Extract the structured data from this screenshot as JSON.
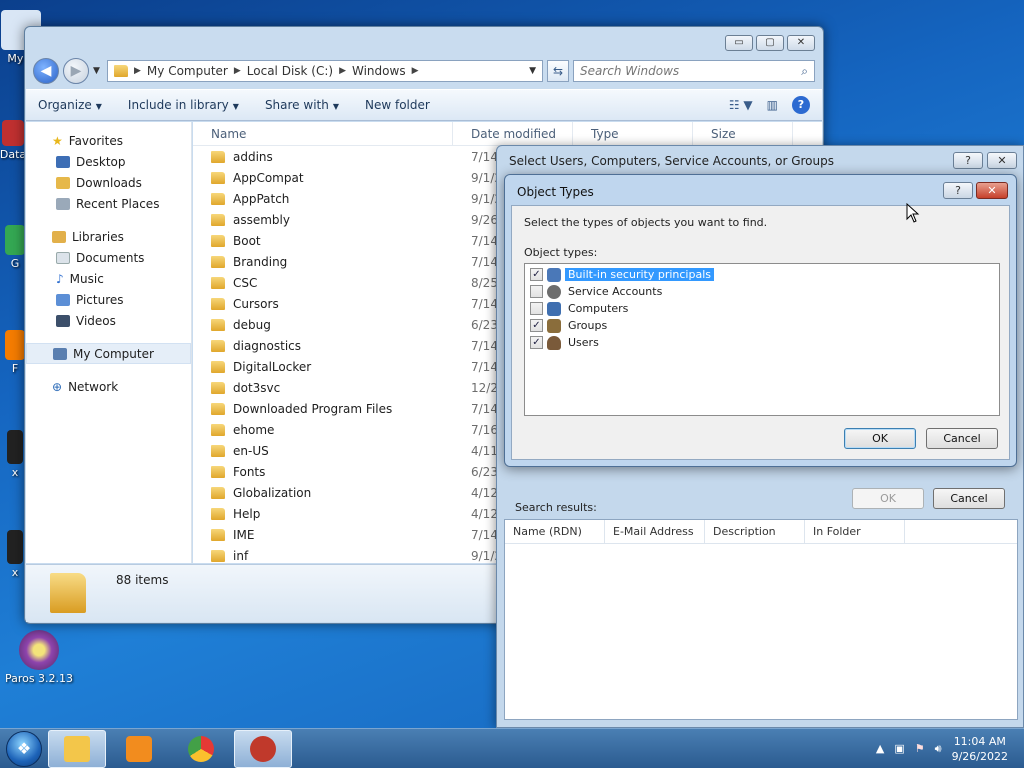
{
  "desktop": {
    "icons": [
      {
        "label": "My C",
        "color": "#d9e6f5"
      },
      {
        "label": "Data",
        "color": "#c03030"
      },
      {
        "label": "G",
        "color": "#34a853"
      },
      {
        "label": "F",
        "color": "#f57c00"
      },
      {
        "label": "x",
        "color": "#222222"
      },
      {
        "label": "x",
        "color": "#222222"
      }
    ],
    "paros": {
      "label": "Paros 3.2.13"
    }
  },
  "explorer": {
    "controls": {
      "minimize": "▭",
      "maximize": "▢",
      "close": "✕"
    },
    "breadcrumb": [
      "My Computer",
      "Local Disk (C:)",
      "Windows"
    ],
    "search_placeholder": "Search Windows",
    "toolbar": {
      "organize": "Organize",
      "include": "Include in library",
      "share": "Share with",
      "new_folder": "New folder"
    },
    "nav": {
      "favorites": "Favorites",
      "desktop": "Desktop",
      "downloads": "Downloads",
      "recent": "Recent Places",
      "libraries": "Libraries",
      "documents": "Documents",
      "music": "Music",
      "pictures": "Pictures",
      "videos": "Videos",
      "computer": "My Computer",
      "network": "Network"
    },
    "columns": {
      "name": "Name",
      "date": "Date modified",
      "type": "Type",
      "size": "Size"
    },
    "files": [
      {
        "name": "addins",
        "date": "7/14/"
      },
      {
        "name": "AppCompat",
        "date": "9/1/2"
      },
      {
        "name": "AppPatch",
        "date": "9/1/2"
      },
      {
        "name": "assembly",
        "date": "9/26/"
      },
      {
        "name": "Boot",
        "date": "7/14/"
      },
      {
        "name": "Branding",
        "date": "7/14/"
      },
      {
        "name": "CSC",
        "date": "8/25/"
      },
      {
        "name": "Cursors",
        "date": "7/14/"
      },
      {
        "name": "debug",
        "date": "6/23/"
      },
      {
        "name": "diagnostics",
        "date": "7/14/"
      },
      {
        "name": "DigitalLocker",
        "date": "7/14/"
      },
      {
        "name": "dot3svc",
        "date": "12/2"
      },
      {
        "name": "Downloaded Program Files",
        "date": "7/14/"
      },
      {
        "name": "ehome",
        "date": "7/16/"
      },
      {
        "name": "en-US",
        "date": "4/11/"
      },
      {
        "name": "Fonts",
        "date": "6/23/"
      },
      {
        "name": "Globalization",
        "date": "4/12/"
      },
      {
        "name": "Help",
        "date": "4/12/"
      },
      {
        "name": "IME",
        "date": "7/14/"
      },
      {
        "name": "inf",
        "date": "9/1/2"
      }
    ],
    "status": {
      "count": "88 items"
    }
  },
  "select_dialog": {
    "title": "Select Users, Computers, Service Accounts, or Groups",
    "help": "?",
    "close": "✕",
    "ok": "OK",
    "cancel": "Cancel",
    "search_results": "Search results:",
    "columns": [
      "Name (RDN)",
      "E-Mail Address",
      "Description",
      "In Folder"
    ]
  },
  "object_types_dialog": {
    "title": "Object Types",
    "help": "?",
    "close": "✕",
    "description": "Select the types of objects you want to find.",
    "list_label": "Object types:",
    "items": [
      {
        "label": "Built-in security principals",
        "checked": "✓",
        "icon_color": "#4a78b8"
      },
      {
        "label": "Service Accounts",
        "checked": "",
        "icon_color": "#6d6d6d"
      },
      {
        "label": "Computers",
        "checked": "",
        "icon_color": "#3f6fb0"
      },
      {
        "label": "Groups",
        "checked": "✓",
        "icon_color": "#8a6d3b"
      },
      {
        "label": "Users",
        "checked": "✓",
        "icon_color": "#7a5a3a"
      }
    ],
    "ok": "OK",
    "cancel": "Cancel"
  },
  "taskbar": {
    "start": "❖",
    "apps": [
      {
        "name": "explorer",
        "color": "#f3c64a"
      },
      {
        "name": "media-player",
        "color": "#f28c1e"
      },
      {
        "name": "chrome",
        "color": "#e53935"
      },
      {
        "name": "paros",
        "color": "#c0392b"
      }
    ],
    "time": "11:04 AM",
    "date": "9/26/2022"
  }
}
